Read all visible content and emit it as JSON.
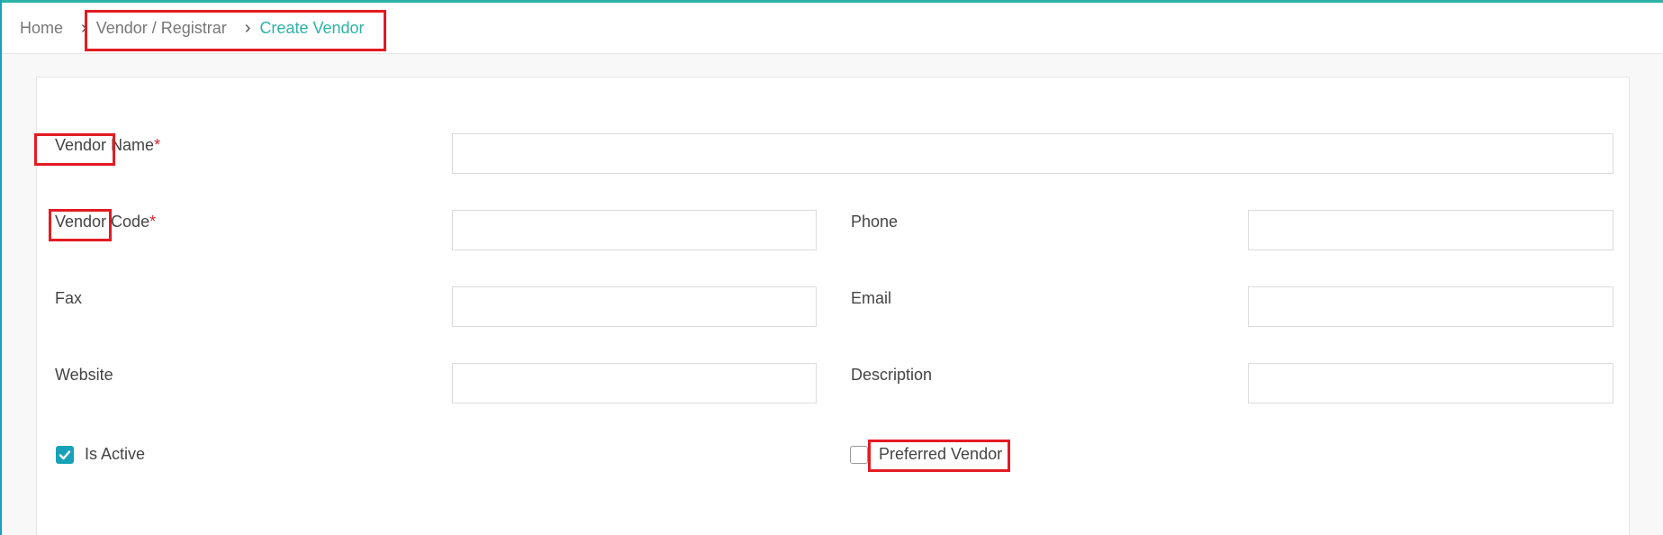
{
  "breadcrumb": {
    "home": "Home",
    "vendor_registrar": "Vendor / Registrar",
    "current": "Create Vendor",
    "separator": "›"
  },
  "form": {
    "vendor_name": {
      "label": "Vendor Name",
      "required_mark": "*",
      "value": ""
    },
    "vendor_code": {
      "label": "Vendor Code",
      "required_mark": "*",
      "value": ""
    },
    "phone": {
      "label": "Phone",
      "value": ""
    },
    "fax": {
      "label": "Fax",
      "value": ""
    },
    "email": {
      "label": "Email",
      "value": ""
    },
    "website": {
      "label": "Website",
      "value": ""
    },
    "description": {
      "label": "Description",
      "value": ""
    },
    "is_active": {
      "label": "Is Active",
      "checked": true
    },
    "preferred_vendor": {
      "label": "Preferred Vendor",
      "checked": false
    }
  },
  "colors": {
    "accent": "#2bb3a6",
    "checkbox": "#17a2b8",
    "required": "#d9262d",
    "highlight": "#e31b23"
  }
}
